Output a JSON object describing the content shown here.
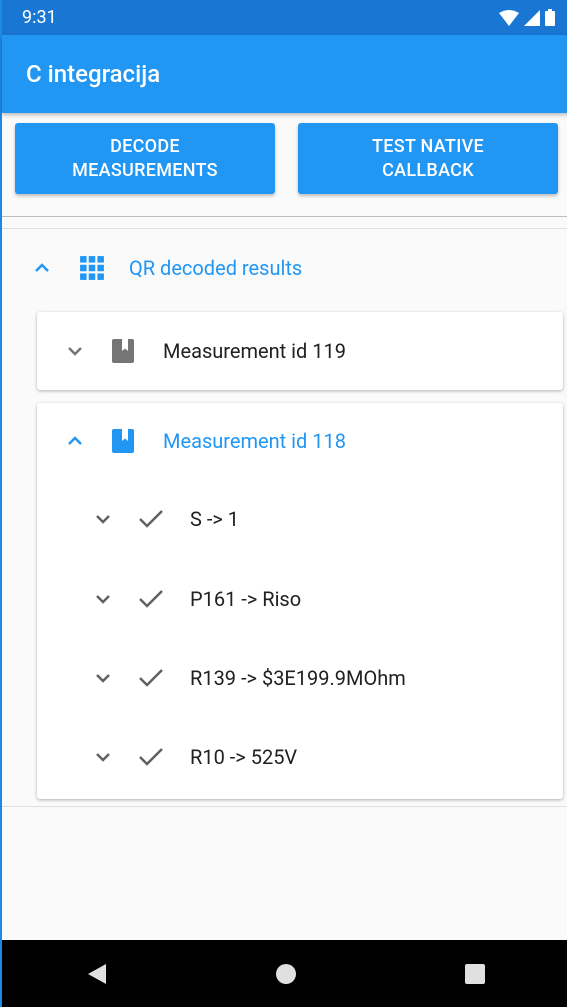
{
  "status_bar": {
    "time": "9:31"
  },
  "app_bar": {
    "title": "C integracija"
  },
  "buttons": {
    "decode": "DECODE\nMEASUREMENTS",
    "test_native": "TEST NATIVE\nCALLBACK"
  },
  "tree": {
    "root_label": "QR decoded results",
    "measurements": [
      {
        "label": "Measurement id 119",
        "expanded": false
      },
      {
        "label": "Measurement id 118",
        "expanded": true,
        "items": [
          "S -> 1",
          "P161 -> Riso",
          "R139 -> $3E199.9MOhm",
          "R10 -> 525V"
        ]
      }
    ]
  },
  "colors": {
    "primary": "#2196f3",
    "primary_dark": "#1976d2",
    "icon_gray": "#757575",
    "text": "#212121"
  }
}
